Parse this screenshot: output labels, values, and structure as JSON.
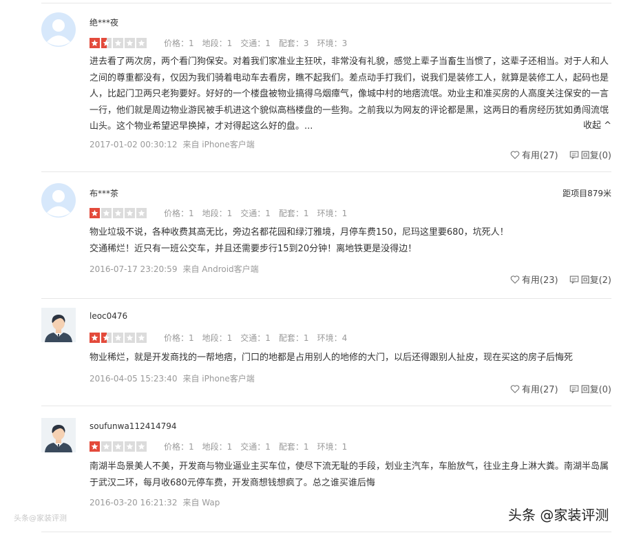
{
  "score_labels": {
    "price": "价格",
    "location": "地段",
    "traffic": "交通",
    "facilities": "配套",
    "environment": "环境"
  },
  "reviews": [
    {
      "username": "绝***夜",
      "avatar": "default-avatar",
      "rating": 1.5,
      "scores": {
        "price": "价格：1",
        "location": "地段：1",
        "traffic": "交通：1",
        "facilities": "配套：3",
        "environment": "环境：3"
      },
      "text": "进去看了两次房，两个看门狗保安。对着我们家准业主狂吠，非常没有礼貌，感觉上辈子当畜生当惯了，这辈子还相当。对于人和人之间的尊重都没有，仅因为我们骑着电动车去看房，瞧不起我们。差点动手打我们，说我们是装修工人，就算是装修工人，起码也是人，比起门卫两只老狗要好。好好的一个楼盘被物业搞得乌烟瘴气，像城中村的地痞流氓。劝业主和准买房的人高度关注保安的一言一行，他们就是周边物业游民被手机进这个貌似高档楼盘的一些狗。之前我以为网友的评论都是黑，这两日的看房经历犹如勇闯流氓山头。这个物业希望迟早换掉，才对得起这么好的盘。...",
      "collapse_label": "收起 ^",
      "date": "2017-01-02 00:30:12",
      "source": "来自 iPhone客户端",
      "helpful": "有用(27)",
      "reply": "回复(0)"
    },
    {
      "username": "布***茶",
      "avatar": "default-avatar",
      "distance": "距项目879米",
      "rating": 1,
      "scores": {
        "price": "价格：1",
        "location": "地段：1",
        "traffic": "交通：1",
        "facilities": "配套：1",
        "environment": "环境：1"
      },
      "text": "物业垃圾不说，各种收费其高无比，旁边名都花园和绿汀雅境，月停车费150，尼玛这里要680，坑死人！\n交通稀烂！近只有一班公交车，并且还需要步行15到20分钟！离地铁更是没得边！",
      "date": "2016-07-17 23:20:59",
      "source": "来自 Android客户端",
      "helpful": "有用(23)",
      "reply": "回复(2)"
    },
    {
      "username": "leoc0476",
      "avatar": "man-avatar",
      "rating": 1.5,
      "scores": {
        "price": "价格：1",
        "location": "地段：1",
        "traffic": "交通：1",
        "facilities": "配套：1",
        "environment": "环境：4"
      },
      "text": "物业稀烂，就是开发商找的一帮地痞，门口的地都是占用别人的地修的大门，以后还得跟别人扯皮，现在买这的房子后悔死",
      "date": "2016-04-05 15:23:40",
      "source": "来自 iPhone客户端",
      "helpful": "有用(27)",
      "reply": "回复(0)"
    },
    {
      "username": "soufunwa112414794",
      "avatar": "man-avatar",
      "rating": 1,
      "scores": {
        "price": "价格：1",
        "location": "地段：1",
        "traffic": "交通：1",
        "facilities": "配套：1",
        "environment": "环境：1"
      },
      "text": "南湖半岛景美人不美，开发商与物业逼业主买车位，使尽下流无耻的手段，划业主汽车，车胎放气，往业主身上淋大粪。南湖半岛属于武汉二环，每月收680元停车费，开发商想钱想疯了。总之谁买谁后悔",
      "date": "2016-03-20 16:21:32",
      "source": "来自 Wap"
    }
  ],
  "watermark_left": "头条@家装评测",
  "watermark_right": "头条 @家装评测",
  "colors": {
    "star_on": "#e34a3b",
    "star_off": "#dcdcdc",
    "meta_text": "#999999"
  }
}
